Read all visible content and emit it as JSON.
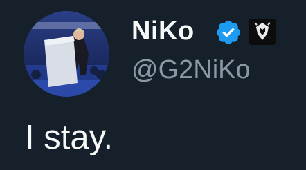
{
  "author": {
    "display_name": "NiKo",
    "handle": "@G2NiKo",
    "verified": true,
    "affiliate_org": "G2 Esports"
  },
  "tweet": {
    "text": "I stay."
  },
  "colors": {
    "background": "#15202b",
    "text_primary": "#f7f9f9",
    "text_secondary": "#8b98a5",
    "verified_blue": "#1d9bf0"
  },
  "icons": {
    "avatar": "profile-photo",
    "verified": "verified-badge-icon",
    "affiliate": "g2-logo-icon"
  }
}
